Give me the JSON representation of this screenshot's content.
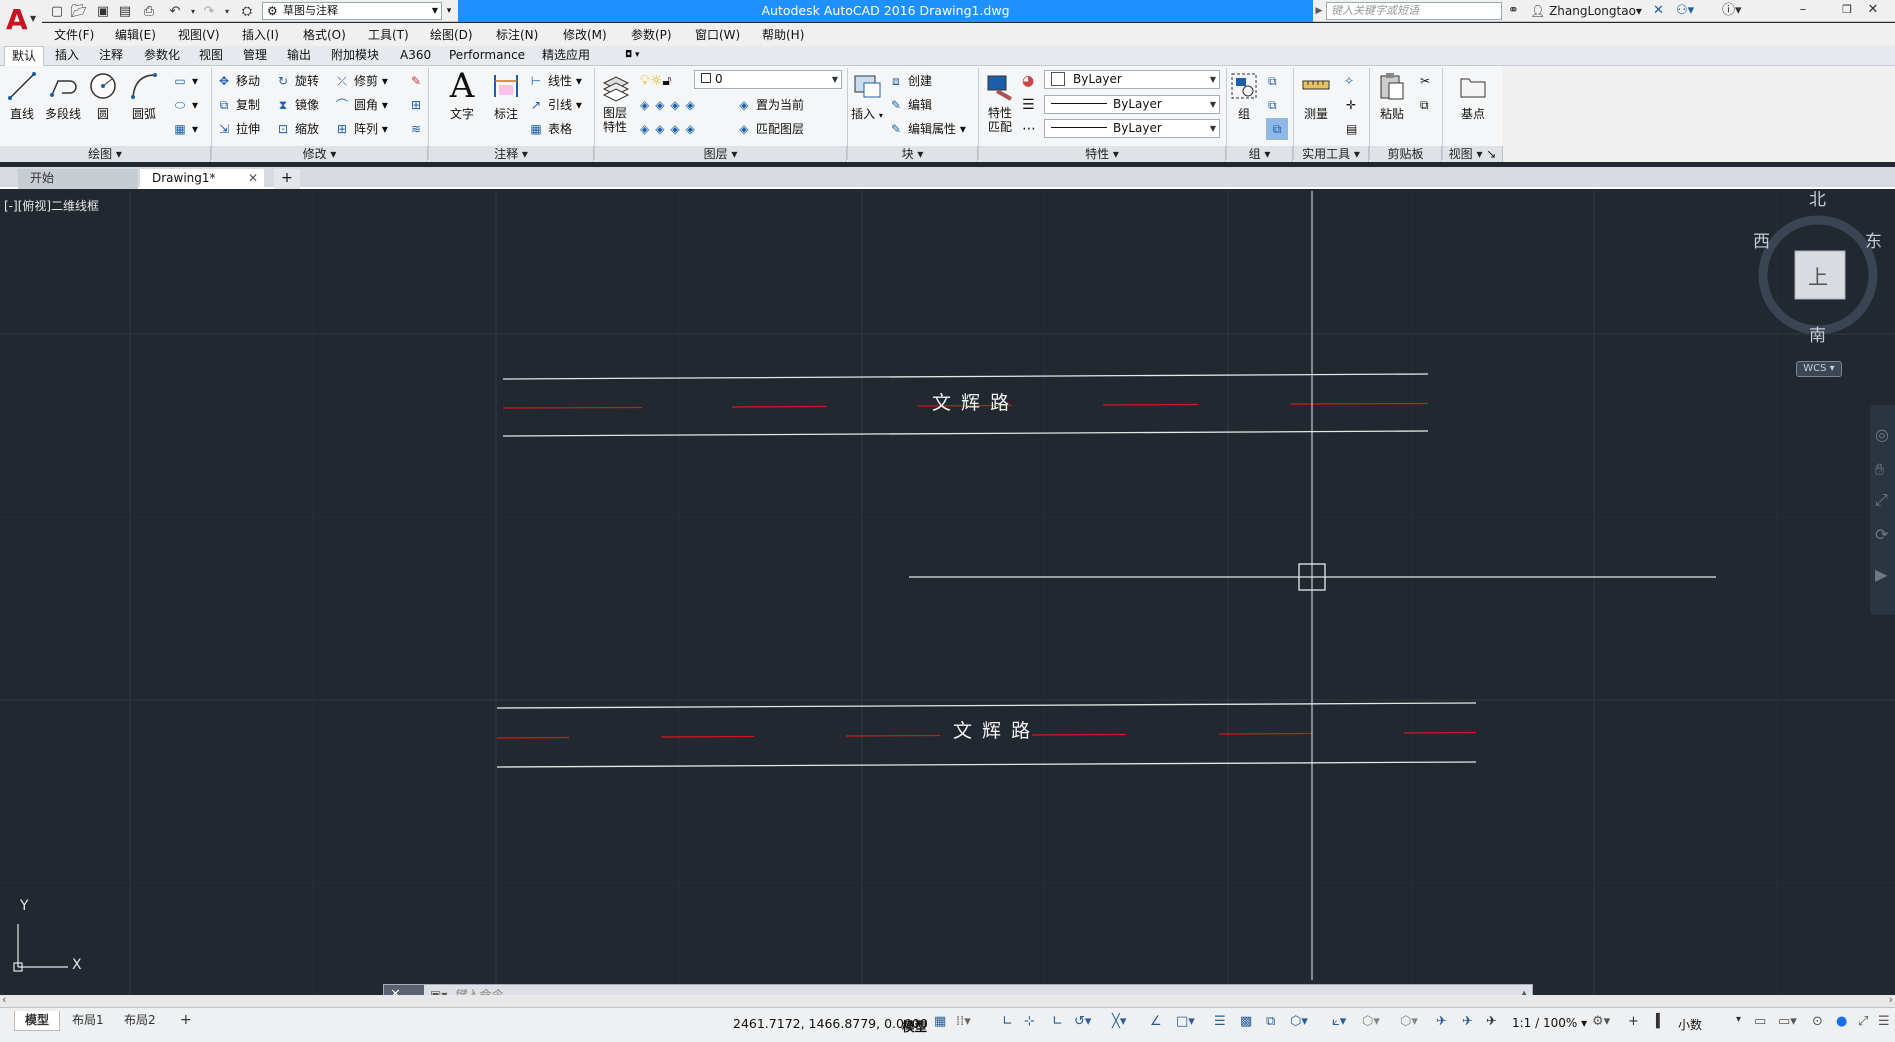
{
  "app": {
    "title": "Autodesk AutoCAD 2016    Drawing1.dwg",
    "workspace": "草图与注释",
    "search_placeholder": "键入关键字或短语",
    "user": "ZhangLongtao"
  },
  "menu": [
    "文件(F)",
    "编辑(E)",
    "视图(V)",
    "插入(I)",
    "格式(O)",
    "工具(T)",
    "绘图(D)",
    "标注(N)",
    "修改(M)",
    "参数(P)",
    "窗口(W)",
    "帮助(H)"
  ],
  "ribbon_tabs": [
    "默认",
    "插入",
    "注释",
    "参数化",
    "视图",
    "管理",
    "输出",
    "附加模块",
    "A360",
    "Performance",
    "精选应用"
  ],
  "ribbon": {
    "draw": {
      "title": "绘图",
      "line": "直线",
      "polyline": "多段线",
      "circle": "圆",
      "arc": "圆弧"
    },
    "modify": {
      "title": "修改",
      "move": "移动",
      "rotate": "旋转",
      "trim": "修剪",
      "copy": "复制",
      "mirror": "镜像",
      "fillet": "圆角",
      "stretch": "拉伸",
      "scale": "缩放",
      "array": "阵列"
    },
    "annotation": {
      "title": "注释",
      "text": "文字",
      "dimension": "标注",
      "linear": "线性",
      "leader": "引线",
      "table": "表格"
    },
    "layers": {
      "title": "图层",
      "props": "图层\n特性",
      "current_layer": "0",
      "set_current": "置为当前",
      "match": "匹配图层"
    },
    "block": {
      "title": "块",
      "insert": "插入",
      "create": "创建",
      "edit": "编辑",
      "edit_attr": "编辑属性"
    },
    "properties": {
      "title": "特性",
      "match": "特性\n匹配",
      "color": "ByLayer",
      "linetype": "ByLayer",
      "lineweight": "ByLayer"
    },
    "groups": {
      "title": "组",
      "group": "组"
    },
    "utilities": {
      "title": "实用工具",
      "measure": "测量"
    },
    "clipboard": {
      "title": "剪贴板",
      "paste": "粘贴"
    },
    "view": {
      "title": "视图",
      "base": "基点"
    }
  },
  "doc_tabs": [
    "开始",
    "Drawing1*"
  ],
  "viewport": {
    "label": "[-][俯视]二维线框",
    "road_text_1": "文 辉 路",
    "road_text_2": "文 辉 路",
    "compass": {
      "north": "北",
      "south": "南",
      "east": "东",
      "west": "西",
      "top": "上",
      "wcs": "WCS"
    },
    "ucs_x": "X",
    "ucs_y": "Y"
  },
  "command": {
    "placeholder": "键入命令"
  },
  "layout_tabs": [
    "模型",
    "布局1",
    "布局2"
  ],
  "status": {
    "coords": "2461.7172, 1466.8779, 0.0000",
    "mode": "模型",
    "scale": "1:1 / 100%",
    "units": "小数"
  }
}
